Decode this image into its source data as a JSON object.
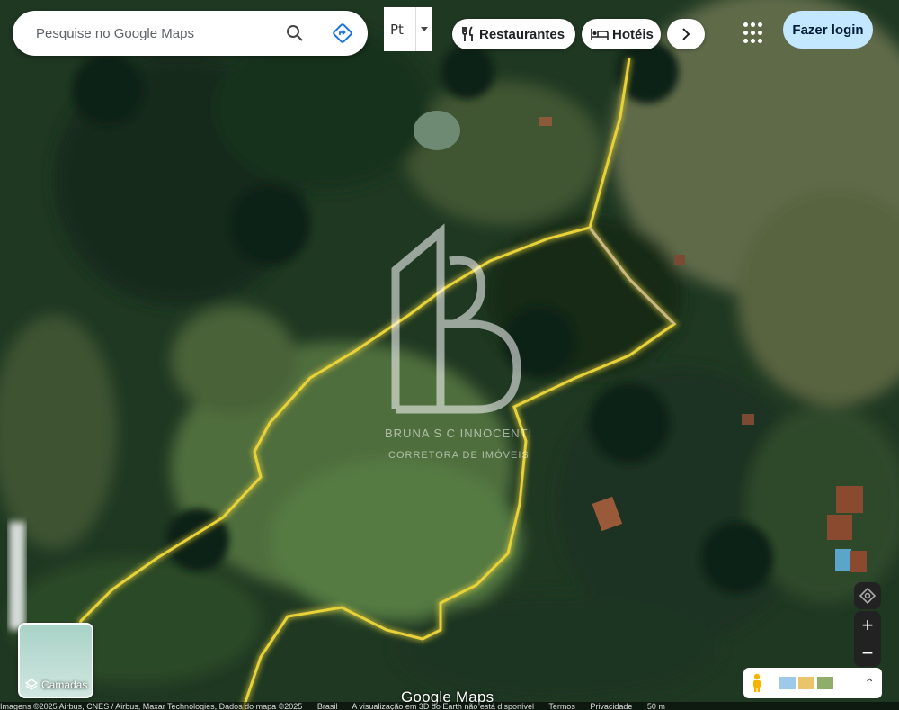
{
  "search": {
    "placeholder": "Pesquise no Google Maps"
  },
  "language": {
    "value": "Pt"
  },
  "chips": {
    "restaurants": "Restaurantes",
    "hotels": "Hotéis"
  },
  "login": {
    "label": "Fazer login"
  },
  "layers": {
    "label": "Camadas"
  },
  "watermark": {
    "brand_line": "BRUNA S C INNOCENTI",
    "sub_line": "CORRETORA DE IMÓVEIS"
  },
  "google_logo": {
    "text": "Google Maps"
  },
  "attribution": {
    "imagery": "Imagens ©2025 Airbus, CNES / Airbus, Maxar Technologies, Dados do mapa ©2025",
    "country": "Brasil",
    "notice": "A visualização em 3D do Earth não está disponível",
    "terms": "Termos",
    "privacy": "Privacidade",
    "scale": "50 m"
  },
  "colors": {
    "login_bg": "#c2e7ff",
    "route": "#e8d23a",
    "accent": "#1a73e8"
  }
}
